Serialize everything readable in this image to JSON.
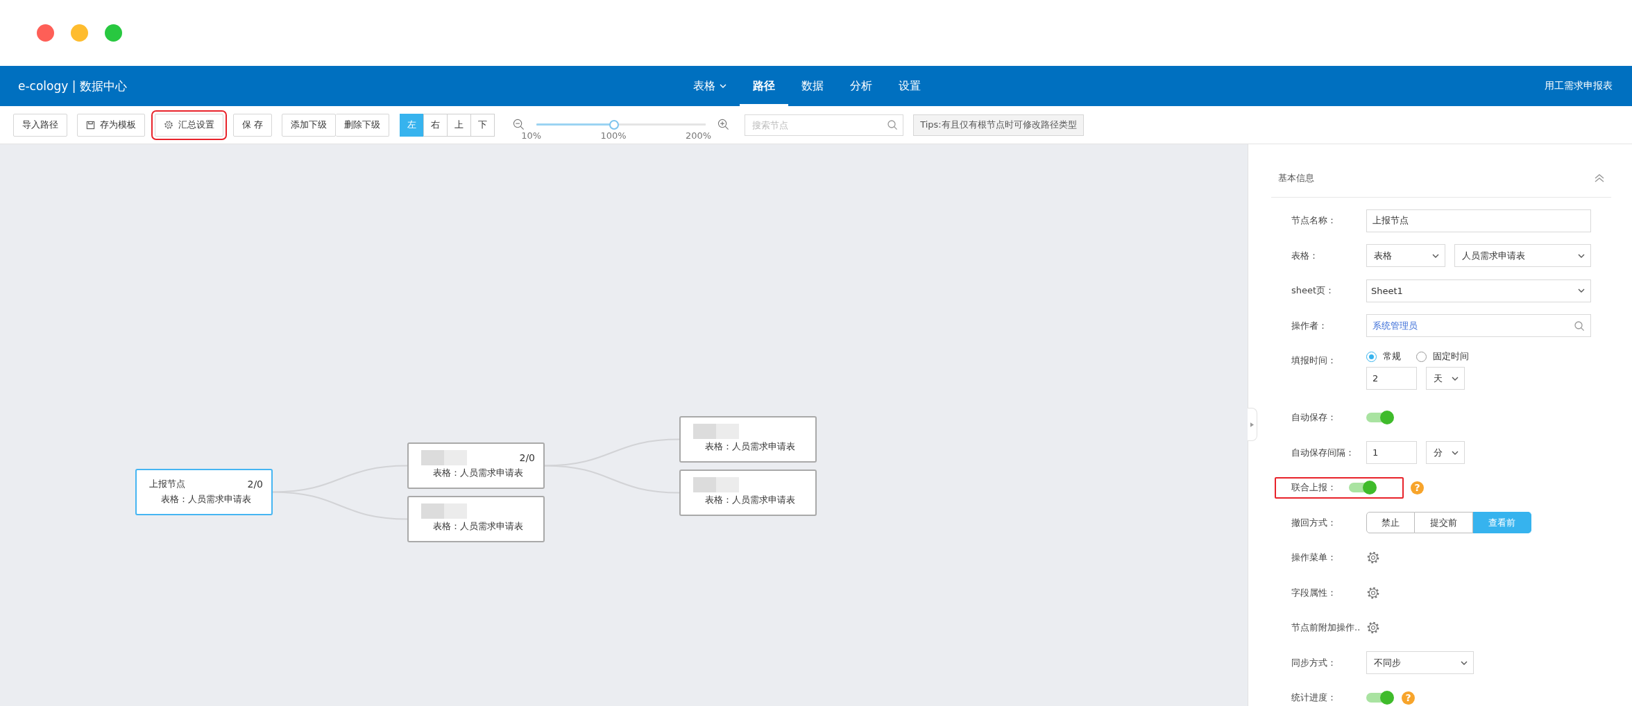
{
  "window": {
    "controls": [
      {
        "color": "#fe5f57"
      },
      {
        "color": "#febc2e"
      },
      {
        "color": "#28c840"
      }
    ]
  },
  "header": {
    "title": "e-cology | 数据中心",
    "nav": [
      {
        "label": "表格",
        "dropdown": true,
        "selected": false
      },
      {
        "label": "路径",
        "dropdown": false,
        "selected": true
      },
      {
        "label": "数据",
        "dropdown": false,
        "selected": false
      },
      {
        "label": "分析",
        "dropdown": false,
        "selected": false
      },
      {
        "label": "设置",
        "dropdown": false,
        "selected": false
      }
    ],
    "right_text": "用工需求申报表"
  },
  "toolbar": {
    "groups": [
      [
        {
          "label": "导入路径",
          "kind": "plain",
          "highlighted": false
        }
      ],
      [
        {
          "label": "存为模板",
          "kind": "document",
          "highlighted": false
        }
      ],
      [
        {
          "label": "汇总设置",
          "kind": "gear",
          "highlighted": true
        }
      ],
      [
        {
          "label": "保 存",
          "kind": "plain",
          "highlighted": false
        }
      ],
      [
        {
          "label": "添加下级",
          "kind": "plain",
          "highlighted": false
        },
        {
          "label": "删除下级",
          "kind": "plain",
          "highlighted": false
        }
      ]
    ],
    "direction": [
      {
        "label": "左",
        "selected": true
      },
      {
        "label": "右",
        "selected": false
      },
      {
        "label": "上",
        "selected": false
      },
      {
        "label": "下",
        "selected": false
      }
    ],
    "zoom": {
      "level": 0.46,
      "labels": [
        "10%",
        "100%",
        "200%"
      ]
    },
    "search": {
      "placeholder": "搜索节点"
    },
    "tips": "Tips:有且仅有根节点时可修改路径类型"
  },
  "nodes": [
    {
      "name": "上报节点",
      "redacted": false,
      "count": "2/0",
      "table": "表格：人员需求申请表",
      "selected": true,
      "children": [
        {
          "redacted": true,
          "count": "2/0",
          "table": "表格：人员需求申请表",
          "selected": false,
          "children": [
            {
              "redacted": true,
              "table": "表格：人员需求申请表",
              "selected": false
            },
            {
              "redacted": true,
              "table": "表格：人员需求申请表",
              "selected": false
            }
          ]
        },
        {
          "redacted": true,
          "table": "表格：人员需求申请表",
          "selected": false
        }
      ]
    }
  ],
  "panel": {
    "section": "基本信息",
    "expanded": true,
    "rows": [
      {
        "kind": "input",
        "label": "节点名称：",
        "value": "上报节点"
      },
      {
        "kind": "select-pair",
        "label": "表格：",
        "values": [
          "表格",
          "人员需求申请表"
        ]
      },
      {
        "kind": "select",
        "label": "sheet页：",
        "value": "Sheet1"
      },
      {
        "kind": "lookup",
        "label": "操作者：",
        "value": "系统管理员"
      },
      {
        "kind": "radio",
        "label": "填报时间：",
        "options": [
          {
            "label": "常规",
            "selected": true
          },
          {
            "label": "固定时间",
            "selected": false
          }
        ],
        "value": "2",
        "unit": "天"
      },
      {
        "kind": "switch",
        "label": "自动保存：",
        "on": true,
        "highlighted": false
      },
      {
        "kind": "number",
        "label": "自动保存间隔：",
        "value": "1",
        "unit": "分"
      },
      {
        "kind": "switch",
        "label": "联合上报：",
        "on": true,
        "highlighted": true,
        "help": "?"
      },
      {
        "kind": "segmented",
        "label": "撤回方式：",
        "options": [
          {
            "label": "禁止",
            "selected": false
          },
          {
            "label": "提交前",
            "selected": false
          },
          {
            "label": "查看前",
            "selected": true
          }
        ]
      },
      {
        "kind": "gear",
        "label": "操作菜单："
      },
      {
        "kind": "gear",
        "label": "字段属性："
      },
      {
        "kind": "gear",
        "label": "节点前附加操作.."
      },
      {
        "kind": "short-select",
        "label": "同步方式：",
        "value": "不同步"
      },
      {
        "kind": "switch",
        "label": "统计进度：",
        "on": true,
        "highlighted": false,
        "help": "?"
      }
    ]
  }
}
